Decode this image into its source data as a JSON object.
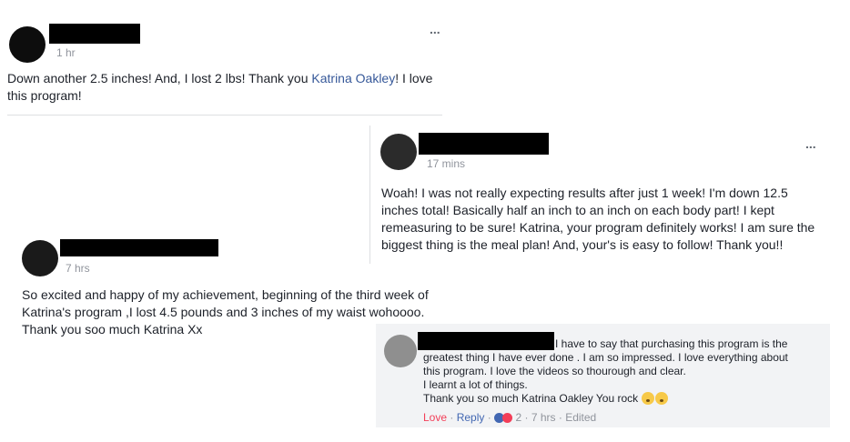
{
  "post1": {
    "time": "1 hr",
    "text_before": "Down another 2.5 inches! And, I lost 2 lbs! Thank you ",
    "mention": "Katrina Oakley",
    "text_after": "! I love this program!"
  },
  "post2": {
    "time": "17 mins",
    "text": "Woah! I was not really expecting results after just 1 week! I'm down 12.5 inches total! Basically half an inch to an inch on each body part! I kept remeasuring to be sure! Katrina, your program definitely works! I am sure the biggest thing is the meal plan! And, your's is easy to follow! Thank you!!"
  },
  "post3": {
    "time": "7 hrs",
    "text": "So excited and happy of my achievement, beginning of the third week of Katrina's program ,I lost 4.5 pounds and 3 inches of my waist wohoooo. Thank you soo much Katrina Xx"
  },
  "comment": {
    "line1": "I have to say that purchasing this program is the",
    "line2": "greatest thing I have ever done . I am so impressed. I love everything about",
    "line3": "this program. I love the videos so thourough and clear.",
    "line4": "I learnt a lot of things.",
    "line5": "Thank you so much Katrina Oakley You rock",
    "love_label": "Love",
    "reply_label": "Reply",
    "reaction_count": "2",
    "time": "7 hrs",
    "edited": "Edited"
  },
  "more_label": "...",
  "colors": {
    "link": "#365899",
    "love": "#f33e58",
    "reply": "#4267b2",
    "comment_bg": "#f2f3f5"
  }
}
